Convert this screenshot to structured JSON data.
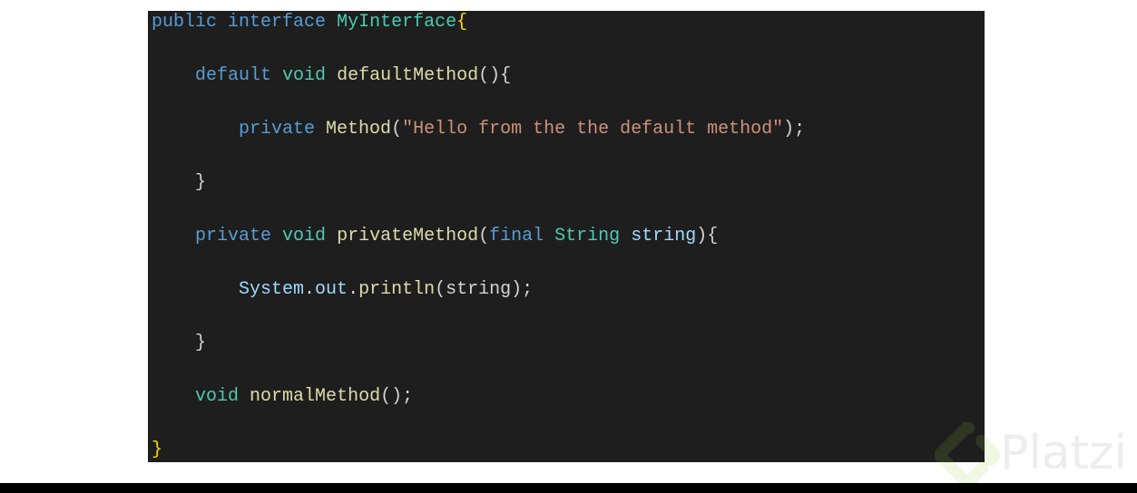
{
  "code": {
    "language": "java",
    "lines": [
      [
        {
          "t": "public",
          "k": "keyword"
        },
        {
          "t": " ",
          "k": "punct"
        },
        {
          "t": "interface",
          "k": "keyword"
        },
        {
          "t": " ",
          "k": "punct"
        },
        {
          "t": "MyInterface",
          "k": "type"
        },
        {
          "t": "{",
          "k": "bracket-gold"
        }
      ],
      [
        {
          "t": "    ",
          "k": "punct"
        },
        {
          "t": "default",
          "k": "keyword"
        },
        {
          "t": " ",
          "k": "punct"
        },
        {
          "t": "void",
          "k": "type"
        },
        {
          "t": " ",
          "k": "punct"
        },
        {
          "t": "defaultMethod",
          "k": "func"
        },
        {
          "t": "(){",
          "k": "punct"
        }
      ],
      [
        {
          "t": "        ",
          "k": "punct"
        },
        {
          "t": "private",
          "k": "keyword"
        },
        {
          "t": " ",
          "k": "punct"
        },
        {
          "t": "Method",
          "k": "func"
        },
        {
          "t": "(",
          "k": "punct"
        },
        {
          "t": "\"Hello from the the default method\"",
          "k": "string"
        },
        {
          "t": ");",
          "k": "punct"
        }
      ],
      [
        {
          "t": "    ",
          "k": "punct"
        },
        {
          "t": "}",
          "k": "punct"
        }
      ],
      [
        {
          "t": "    ",
          "k": "punct"
        },
        {
          "t": "private",
          "k": "keyword"
        },
        {
          "t": " ",
          "k": "punct"
        },
        {
          "t": "void",
          "k": "type"
        },
        {
          "t": " ",
          "k": "punct"
        },
        {
          "t": "privateMethod",
          "k": "func"
        },
        {
          "t": "(",
          "k": "punct"
        },
        {
          "t": "final",
          "k": "keyword"
        },
        {
          "t": " ",
          "k": "punct"
        },
        {
          "t": "String",
          "k": "type"
        },
        {
          "t": " ",
          "k": "punct"
        },
        {
          "t": "string",
          "k": "var"
        },
        {
          "t": "){",
          "k": "punct"
        }
      ],
      [
        {
          "t": "        ",
          "k": "punct"
        },
        {
          "t": "System",
          "k": "var"
        },
        {
          "t": ".",
          "k": "punct"
        },
        {
          "t": "out",
          "k": "var"
        },
        {
          "t": ".",
          "k": "punct"
        },
        {
          "t": "println",
          "k": "func"
        },
        {
          "t": "(string);",
          "k": "punct"
        }
      ],
      [
        {
          "t": "    ",
          "k": "punct"
        },
        {
          "t": "}",
          "k": "punct"
        }
      ],
      [
        {
          "t": "    ",
          "k": "punct"
        },
        {
          "t": "void",
          "k": "type"
        },
        {
          "t": " ",
          "k": "punct"
        },
        {
          "t": "normalMethod",
          "k": "func"
        },
        {
          "t": "();",
          "k": "punct"
        }
      ],
      [
        {
          "t": "}",
          "k": "bracket-gold"
        }
      ]
    ]
  },
  "theme": {
    "background": "#1e1e1e",
    "keyword": "#569cd6",
    "type": "#4ec9b0",
    "function": "#dcdcaa",
    "string": "#ce9178",
    "variable": "#9cdcfe",
    "punctuation": "#d4d4d4",
    "bracket_gold": "#ffd700"
  },
  "watermark": {
    "brand": "Platzi",
    "icon": "platzi-logo-icon",
    "color": "#98ca3f"
  }
}
